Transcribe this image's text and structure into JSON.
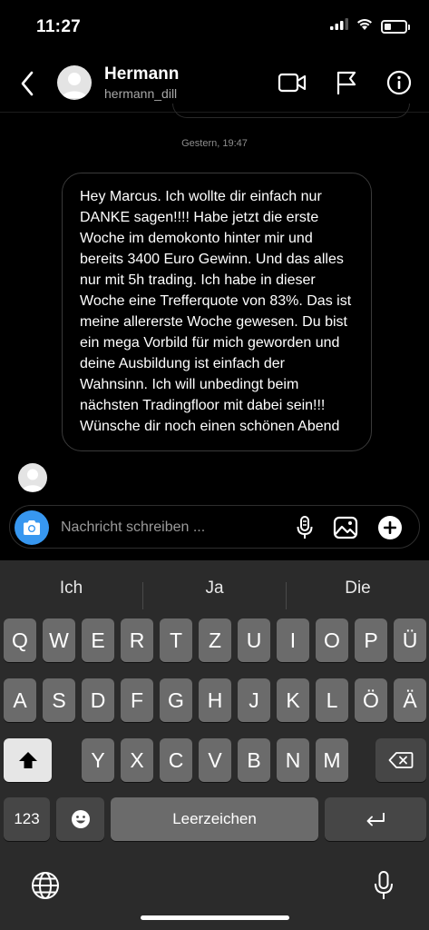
{
  "status_bar": {
    "time": "11:27"
  },
  "header": {
    "name": "Hermann",
    "username": "hermann_dill"
  },
  "chat": {
    "timestamp": "Gestern, 19:47",
    "message": "Hey Marcus. Ich wollte dir einfach nur DANKE sagen!!!! Habe jetzt die erste Woche im demokonto hinter mir und bereits 3400 Euro Gewinn. Und das alles nur mit 5h trading. Ich habe in dieser Woche eine Trefferquote von 83%. Das ist meine allererste Woche gewesen. Du bist ein mega Vorbild für mich geworden und deine Ausbildung ist einfach der Wahnsinn. Ich will unbedingt beim nächsten Tradingfloor mit dabei sein!!!\nWünsche dir noch einen schönen Abend"
  },
  "composer": {
    "placeholder": "Nachricht schreiben ..."
  },
  "keyboard": {
    "suggestions": [
      "Ich",
      "Ja",
      "Die"
    ],
    "row1": [
      "Q",
      "W",
      "E",
      "R",
      "T",
      "Z",
      "U",
      "I",
      "O",
      "P",
      "Ü"
    ],
    "row2": [
      "A",
      "S",
      "D",
      "F",
      "G",
      "H",
      "J",
      "K",
      "L",
      "Ö",
      "Ä"
    ],
    "row3": [
      "Y",
      "X",
      "C",
      "V",
      "B",
      "N",
      "M"
    ],
    "numbers_label": "123",
    "space_label": "Leerzeichen"
  },
  "icons": {
    "back": "chevron-left-icon",
    "video": "video-camera-icon",
    "report": "flag-icon",
    "info": "info-icon",
    "camera": "camera-icon",
    "mic": "microphone-icon",
    "gallery": "image-icon",
    "add": "plus-circle-icon",
    "shift": "shift-icon",
    "backspace": "backspace-icon",
    "emoji": "emoji-icon",
    "return": "return-icon",
    "globe": "globe-icon",
    "dictation": "microphone-icon"
  },
  "colors": {
    "accent": "#3797f0",
    "background": "#000000",
    "keyboard": "#2b2b2b"
  }
}
